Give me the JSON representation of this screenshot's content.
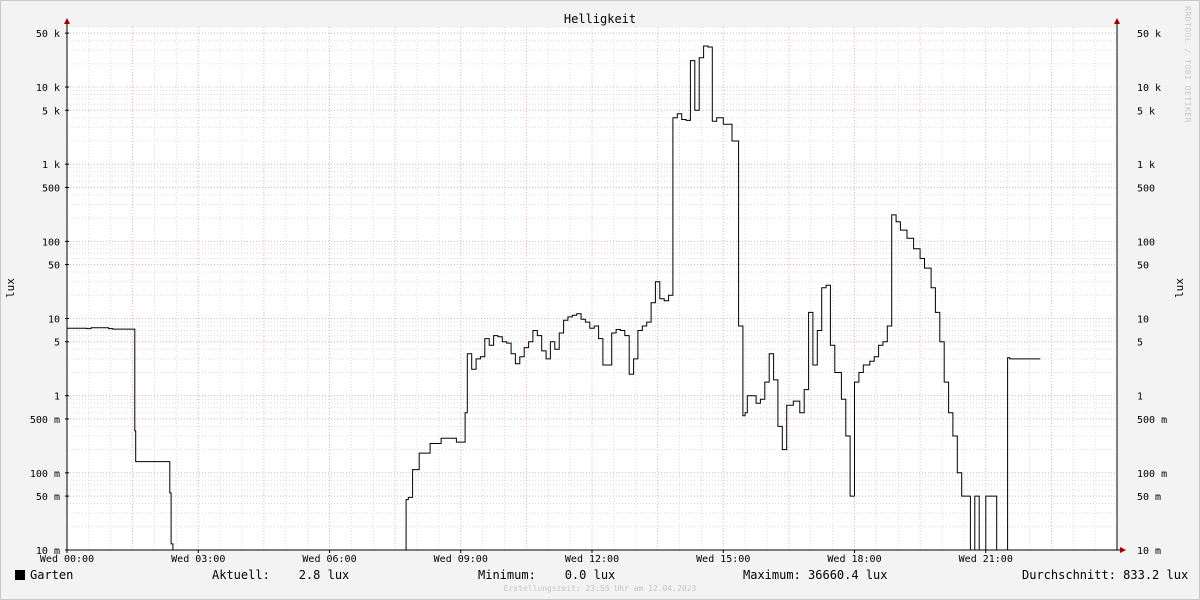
{
  "chart_data": {
    "type": "line",
    "title": "Helligkeit",
    "ylabel": "lux",
    "y_scale": "log",
    "ylim": [
      0.01,
      60000
    ],
    "xlim_hours": [
      0,
      24
    ],
    "x_tick_labels": [
      "Wed 00:00",
      "Wed 03:00",
      "Wed 06:00",
      "Wed 09:00",
      "Wed 12:00",
      "Wed 15:00",
      "Wed 18:00",
      "Wed 21:00"
    ],
    "y_ticks": [
      {
        "value": 0.01,
        "label": "10 m"
      },
      {
        "value": 0.05,
        "label": "50 m"
      },
      {
        "value": 0.1,
        "label": "100 m"
      },
      {
        "value": 0.5,
        "label": "500 m"
      },
      {
        "value": 1,
        "label": "1"
      },
      {
        "value": 5,
        "label": "5"
      },
      {
        "value": 10,
        "label": "10"
      },
      {
        "value": 50,
        "label": "50"
      },
      {
        "value": 100,
        "label": "100"
      },
      {
        "value": 500,
        "label": "500"
      },
      {
        "value": 1000,
        "label": "1 k"
      },
      {
        "value": 5000,
        "label": "5 k"
      },
      {
        "value": 10000,
        "label": "10 k"
      },
      {
        "value": 50000,
        "label": "50 k"
      }
    ],
    "grid": true,
    "series": [
      {
        "name": "Garten",
        "color": "#000000",
        "step": true,
        "x_hours": [
          0.0,
          0.45,
          0.55,
          0.95,
          1.05,
          1.55,
          1.57,
          1.62,
          2.35,
          2.38,
          2.42,
          7.4,
          7.75,
          7.8,
          7.9,
          8.05,
          8.3,
          8.55,
          8.9,
          9.1,
          9.15,
          9.25,
          9.35,
          9.45,
          9.55,
          9.65,
          9.75,
          9.85,
          9.95,
          10.05,
          10.15,
          10.25,
          10.35,
          10.45,
          10.55,
          10.65,
          10.75,
          10.85,
          10.95,
          11.05,
          11.15,
          11.25,
          11.35,
          11.45,
          11.55,
          11.65,
          11.75,
          11.85,
          11.95,
          12.05,
          12.15,
          12.25,
          12.35,
          12.45,
          12.55,
          12.65,
          12.75,
          12.85,
          12.95,
          13.05,
          13.15,
          13.25,
          13.35,
          13.45,
          13.55,
          13.65,
          13.75,
          13.85,
          13.95,
          14.05,
          14.15,
          14.25,
          14.35,
          14.45,
          14.55,
          14.65,
          14.75,
          14.85,
          15.0,
          15.2,
          15.35,
          15.45,
          15.5,
          15.55,
          15.75,
          15.85,
          15.95,
          16.05,
          16.15,
          16.25,
          16.35,
          16.45,
          16.6,
          16.75,
          16.85,
          16.95,
          17.05,
          17.15,
          17.25,
          17.35,
          17.45,
          17.55,
          17.7,
          17.8,
          17.9,
          18.0,
          18.1,
          18.2,
          18.35,
          18.45,
          18.55,
          18.65,
          18.75,
          18.85,
          18.95,
          19.05,
          19.2,
          19.35,
          19.5,
          19.6,
          19.75,
          19.85,
          19.95,
          20.05,
          20.15,
          20.25,
          20.35,
          20.45,
          20.55,
          20.65,
          20.75,
          20.85,
          21.0,
          21.25,
          21.45,
          21.5,
          21.55,
          21.75,
          21.8,
          21.85,
          22.25,
          22.75,
          22.9
        ],
        "values": [
          7.5,
          7.4,
          7.6,
          7.4,
          7.3,
          0.35,
          0.14,
          0.14,
          0.055,
          0.012,
          0.01,
          0.01,
          0.045,
          0.048,
          0.11,
          0.18,
          0.24,
          0.28,
          0.25,
          0.6,
          3.5,
          2.2,
          3.0,
          3.2,
          5.5,
          4.5,
          6.0,
          5.8,
          5.0,
          4.8,
          3.5,
          2.6,
          3.2,
          4.2,
          5.0,
          7.0,
          6.0,
          3.8,
          3.0,
          5.0,
          4.0,
          6.5,
          9.5,
          10.5,
          11.0,
          11.5,
          9.8,
          9.0,
          7.5,
          8.0,
          5.5,
          2.5,
          2.5,
          6.5,
          7.2,
          7.0,
          6.0,
          1.9,
          3.0,
          7.0,
          8.0,
          9.0,
          16.0,
          30.0,
          18.0,
          17.0,
          20.0,
          4000,
          4500,
          3800,
          3700,
          22000,
          5000,
          24000,
          34000,
          33000,
          3600,
          4000,
          3300,
          2000,
          8.0,
          0.55,
          0.6,
          1.0,
          0.8,
          0.9,
          1.5,
          3.5,
          1.6,
          0.4,
          0.2,
          0.75,
          0.85,
          0.6,
          1.2,
          12.0,
          2.5,
          7.0,
          25.0,
          27.0,
          4.5,
          2.0,
          0.9,
          0.3,
          0.05,
          1.5,
          2.0,
          2.5,
          2.8,
          3.2,
          4.5,
          5.0,
          8.0,
          220,
          180,
          140,
          110,
          80,
          60,
          45,
          25,
          12,
          5.0,
          1.5,
          0.6,
          0.3,
          0.1,
          0.05,
          0.05,
          0.01,
          0.05,
          0.01,
          0.05,
          0.01,
          0.01,
          3.1,
          3.0,
          3.0,
          3.0,
          3.0
        ]
      }
    ]
  },
  "legend": {
    "series_name": "Garten",
    "current": "Aktuell:    2.8 lux",
    "minimum": "Minimum:    0.0 lux",
    "maximum": "Maximum: 36660.4 lux",
    "average": "Durchschnitt: 833.2 lux"
  },
  "footer": "Erstellungszeit: 23:55 Uhr am 12.04.2023",
  "watermark": "RRDTOOL / TOBI OETIKER"
}
